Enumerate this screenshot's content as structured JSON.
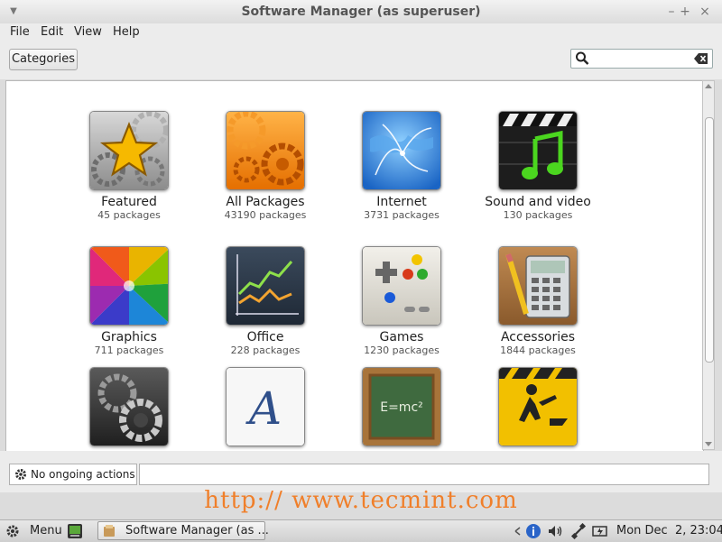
{
  "window": {
    "title": "Software Manager (as superuser)",
    "controls": [
      "–",
      "+",
      "×"
    ]
  },
  "menubar": {
    "items": [
      "File",
      "Edit",
      "View",
      "Help"
    ]
  },
  "toolbar": {
    "categories_label": "Categories",
    "search_value": "",
    "search_placeholder": ""
  },
  "categories": [
    {
      "name": "Featured",
      "count": "45 packages",
      "icon": "star-gears-icon"
    },
    {
      "name": "All Packages",
      "count": "43190 packages",
      "icon": "orange-gears-icon"
    },
    {
      "name": "Internet",
      "count": "3731 packages",
      "icon": "globe-network-icon"
    },
    {
      "name": "Sound and video",
      "count": "130 packages",
      "icon": "music-clapper-icon"
    },
    {
      "name": "Graphics",
      "count": "711 packages",
      "icon": "color-wheel-icon"
    },
    {
      "name": "Office",
      "count": "228 packages",
      "icon": "line-chart-icon"
    },
    {
      "name": "Games",
      "count": "1230 packages",
      "icon": "gamepad-icon"
    },
    {
      "name": "Accessories",
      "count": "1844 packages",
      "icon": "calculator-icon"
    },
    {
      "name": "",
      "count": "",
      "icon": "dark-gears-icon"
    },
    {
      "name": "",
      "count": "",
      "icon": "font-icon"
    },
    {
      "name": "",
      "count": "",
      "icon": "chalkboard-icon"
    },
    {
      "name": "",
      "count": "",
      "icon": "construction-sign-icon"
    }
  ],
  "status": {
    "text": "No ongoing actions"
  },
  "watermark": "http:// www.tecmint.com",
  "taskbar": {
    "menu_label": "Menu",
    "task_label": "Software Manager (as ...",
    "clock": "Mon Dec  2, 23:04"
  },
  "colors": {
    "watermark": "#f07f2a",
    "window_bg": "#ececec"
  }
}
